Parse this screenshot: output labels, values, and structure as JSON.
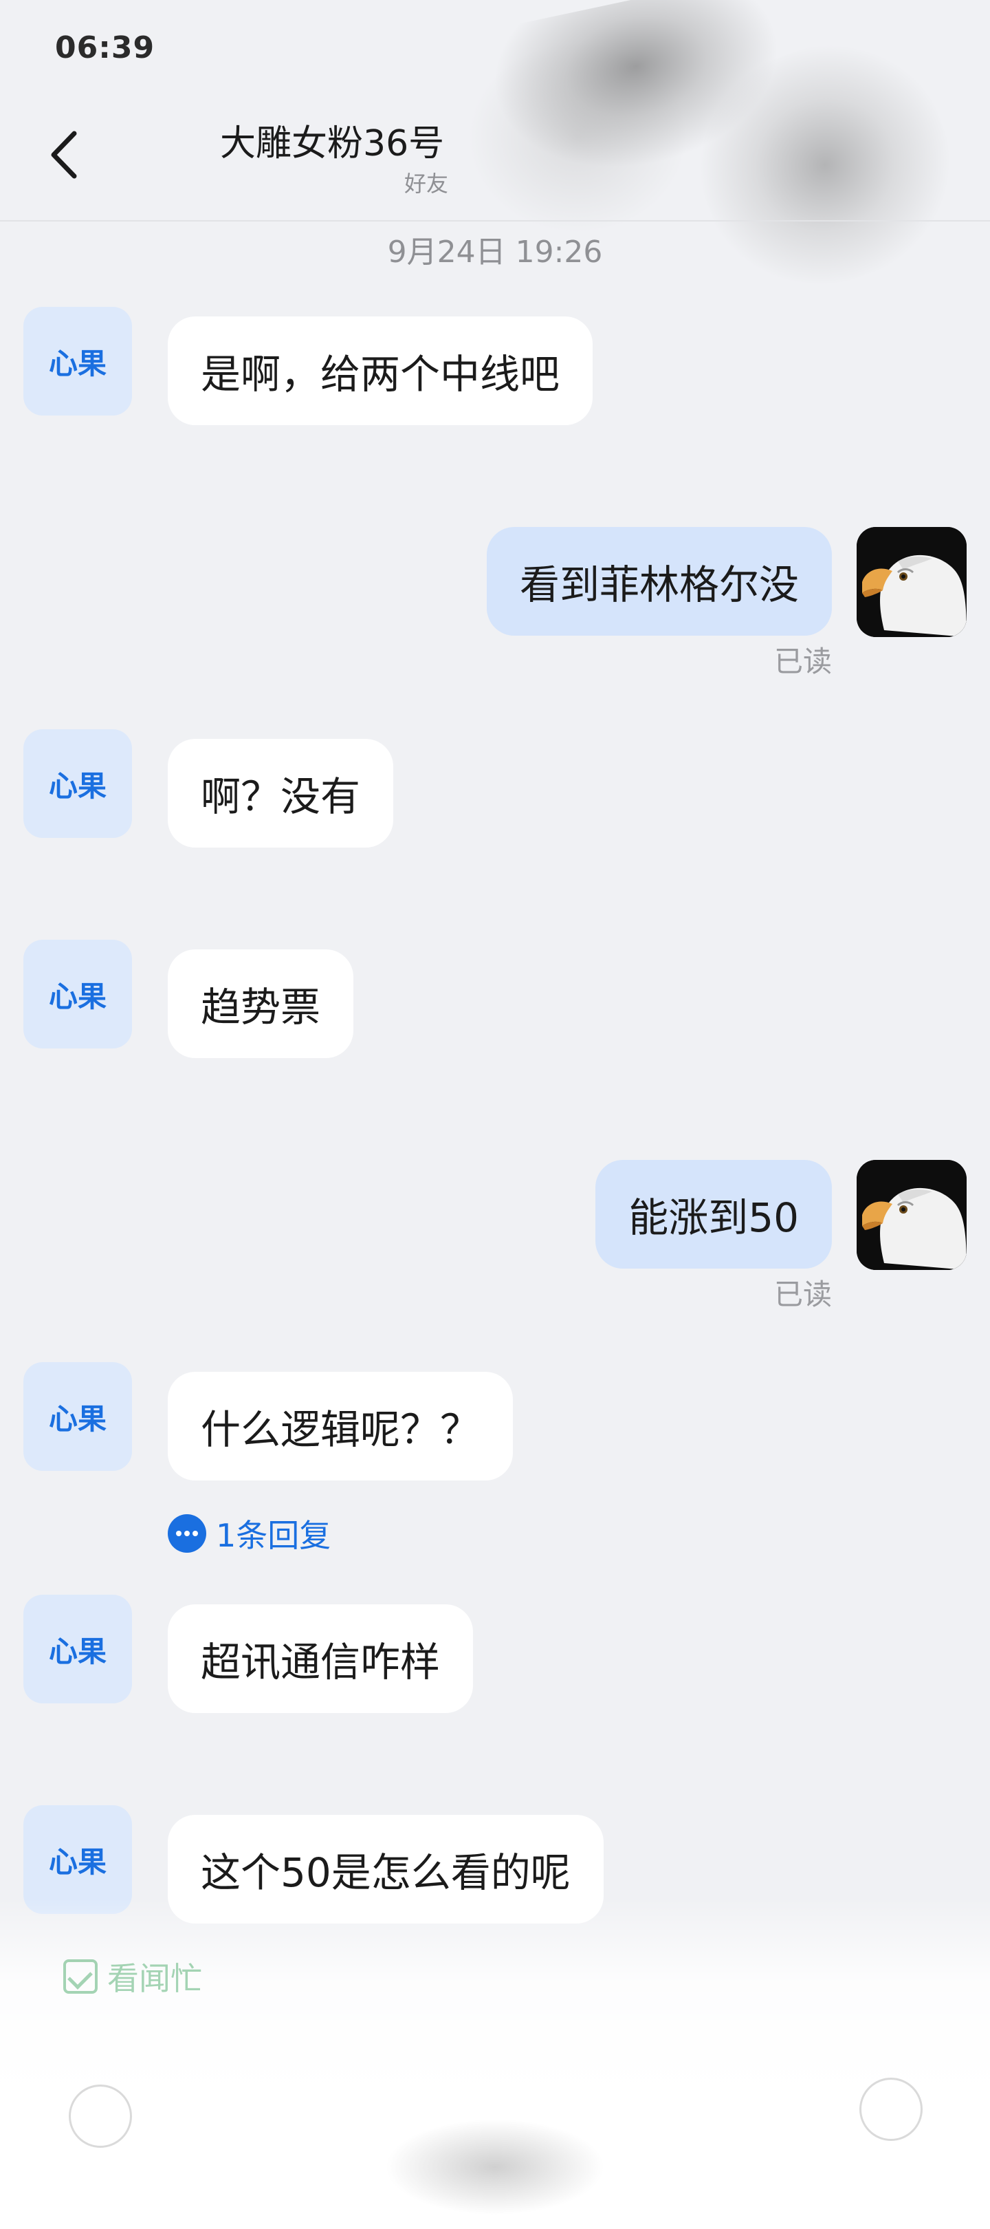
{
  "status_bar": {
    "time": "06:39"
  },
  "header": {
    "title": "大雕女粉36号",
    "subtitle": "好友",
    "back_icon": "chevron-left-icon"
  },
  "timestamp": "9月24日 19:26",
  "contact_avatar_label": "心果",
  "my_avatar_icon": "eagle-avatar-icon",
  "messages": [
    {
      "side": "in",
      "text": "是啊，给两个中线吧"
    },
    {
      "side": "out",
      "text": "看到菲林格尔没",
      "status": "已读"
    },
    {
      "side": "in",
      "text": "啊？没有"
    },
    {
      "side": "in",
      "text": "趋势票"
    },
    {
      "side": "out",
      "text": "能涨到50",
      "status": "已读"
    },
    {
      "side": "in",
      "text": "什么逻辑呢？？",
      "reply_count_label": "1条回复"
    },
    {
      "side": "in",
      "text": "超讯通信咋样"
    },
    {
      "side": "in",
      "text": "这个50是怎么看的呢"
    }
  ],
  "bottom_bar": {
    "chip_label": "看闻忙",
    "chip_icon": "checkbox-icon",
    "voice_icon": "voice-icon",
    "plus_icon": "plus-icon"
  },
  "colors": {
    "accent": "#1a6fe0",
    "incoming_bubble": "#ffffff",
    "outgoing_bubble": "#d5e4fb",
    "background": "#f0f1f4"
  }
}
